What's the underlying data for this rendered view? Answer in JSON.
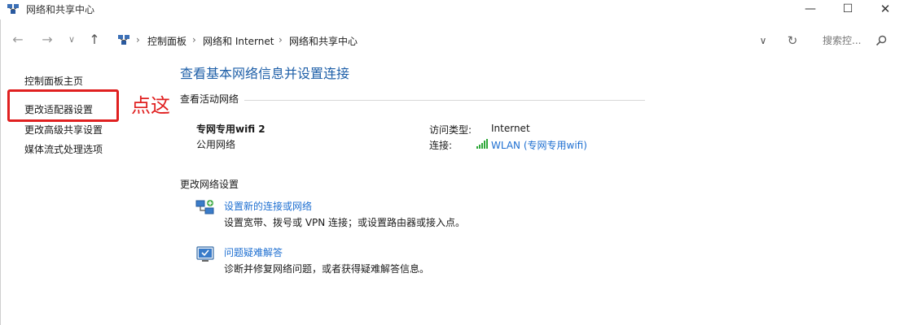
{
  "window": {
    "title": "网络和共享中心",
    "minimize_glyph": "—",
    "maximize_glyph": "☐",
    "close_glyph": "✕"
  },
  "navigation": {
    "back_glyph": "←",
    "forward_glyph": "→",
    "recent_glyph": "∨",
    "up_glyph": "↑",
    "separator_glyph": "›",
    "breadcrumbs": [
      "控制面板",
      "网络和 Internet",
      "网络和共享中心"
    ],
    "dropdown_glyph": "∨",
    "refresh_glyph": "↻",
    "search_placeholder": "搜索控..."
  },
  "sidebar": {
    "items": [
      {
        "label": "控制面板主页"
      },
      {
        "label": "更改适配器设置"
      },
      {
        "label": "更改高级共享设置"
      },
      {
        "label": "媒体流式处理选项"
      }
    ]
  },
  "annotation": {
    "text": "点这",
    "color": "#e02020"
  },
  "main": {
    "title": "查看基本网络信息并设置连接",
    "active_networks_label": "查看活动网络",
    "network": {
      "name": "专网专用wifi 2",
      "category": "公用网络",
      "access_type_label": "访问类型:",
      "access_type_value": "Internet",
      "connections_label": "连接:",
      "connection_link": "WLAN (专网专用wifi)"
    },
    "change_settings_label": "更改网络设置",
    "tasks": [
      {
        "icon": "network-setup-icon",
        "link": "设置新的连接或网络",
        "description": "设置宽带、拨号或 VPN 连接；或设置路由器或接入点。"
      },
      {
        "icon": "troubleshoot-icon",
        "link": "问题疑难解答",
        "description": "诊断并修复网络问题，或者获得疑难解答信息。"
      }
    ]
  },
  "colors": {
    "title_blue": "#1e5fa8",
    "link_blue": "#1e6fd1",
    "wifi_green": "#2fa83a"
  }
}
